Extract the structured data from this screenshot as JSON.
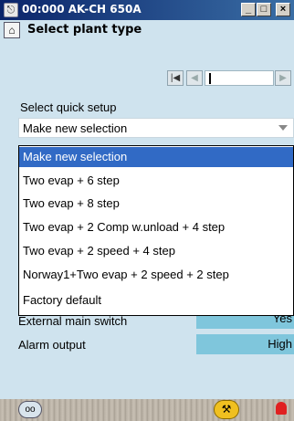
{
  "window": {
    "title": "00:000 AK-CH 650A",
    "min_label": "_",
    "max_label": "□",
    "close_label": "×"
  },
  "header": {
    "title": "Select plant type"
  },
  "nav": {
    "first": "|◀",
    "prev": "◀",
    "next": "▶"
  },
  "quick_setup": {
    "label": "Select quick setup",
    "value": "Make new selection"
  },
  "dropdown": {
    "items": [
      "Make new selection",
      "Two evap + 6 step",
      "Two evap + 8 step",
      "Two evap + 2 Comp w.unload + 4 step",
      "Two evap + 2 speed + 4 step",
      "Norway1+Two evap + 2 speed + 2 step",
      "Factory default"
    ],
    "selected_index": 0
  },
  "rows": [
    {
      "label": "External main switch",
      "value": "Yes"
    },
    {
      "label": "Alarm output",
      "value": "High"
    }
  ],
  "icons": {
    "title": "app-icon",
    "home": "home-icon",
    "bottom_left": "binoculars-icon",
    "bottom_mid": "wrench-icon",
    "bottom_right": "alarm-bell-icon"
  },
  "colors": {
    "titlebar": "#0a246a",
    "panel": "#cfe3ee",
    "value_cell": "#7fc6dc",
    "selection": "#316ac5",
    "alarm": "#e02020"
  }
}
